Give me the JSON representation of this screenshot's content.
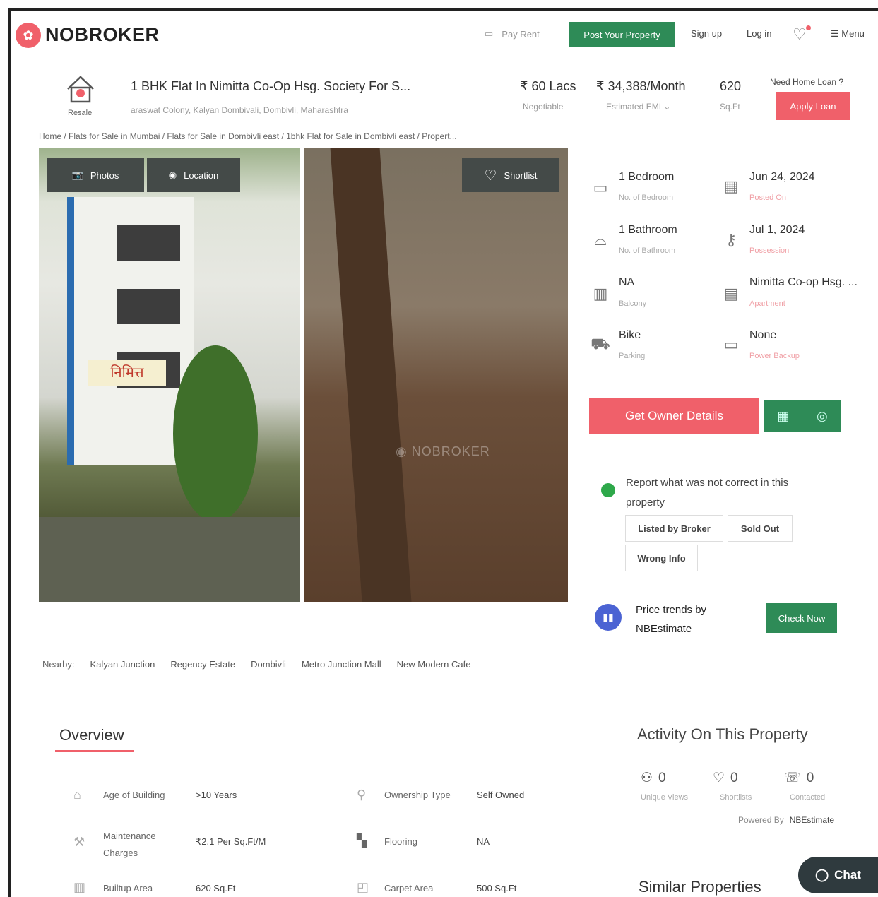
{
  "header": {
    "logo": "NOBROKER",
    "pay_rent": "Pay Rent",
    "post_property": "Post Your Property",
    "sign_up": "Sign up",
    "log_in": "Log in",
    "menu": "Menu"
  },
  "listing": {
    "type_label": "Resale",
    "title": "1 BHK Flat In Nimitta Co-Op Hsg. Society For S...",
    "address": "araswat Colony, Kalyan Dombivali, Dombivli, Maharashtra",
    "price": "₹ 60 Lacs",
    "price_note": "Negotiable",
    "emi": "₹ 34,388/Month",
    "emi_note": "Estimated EMI",
    "area": "620",
    "area_unit": "Sq.Ft",
    "loan_question": "Need Home Loan ?",
    "apply_loan": "Apply Loan"
  },
  "breadcrumb": "Home / Flats for Sale in Mumbai / Flats for Sale in Dombivli east / 1bhk Flat for Sale in Dombivli east / Propert...",
  "gallery": {
    "photos": "Photos",
    "location": "Location",
    "shortlist": "Shortlist",
    "sign_text": "निमित्त",
    "watermark": "NOBROKER"
  },
  "specs": [
    {
      "value": "1 Bedroom",
      "label": "No. of Bedroom",
      "icon": "bed-icon"
    },
    {
      "value": "Jun 24, 2024",
      "label": "Posted On",
      "icon": "calendar-icon"
    },
    {
      "value": "1 Bathroom",
      "label": "No. of Bathroom",
      "icon": "bathtub-icon"
    },
    {
      "value": "Jul 1, 2024",
      "label": "Possession",
      "icon": "key-icon"
    },
    {
      "value": "NA",
      "label": "Balcony",
      "icon": "balcony-icon"
    },
    {
      "value": "Nimitta Co-op Hsg. ...",
      "label": "Apartment",
      "icon": "building-icon"
    },
    {
      "value": "Bike",
      "label": "Parking",
      "icon": "car-icon"
    },
    {
      "value": "None",
      "label": "Power Backup",
      "icon": "battery-icon"
    }
  ],
  "actions": {
    "get_owner": "Get Owner Details"
  },
  "report": {
    "text": "Report what was not correct in this property",
    "chips": [
      "Listed by Broker",
      "Sold Out",
      "Wrong Info"
    ]
  },
  "price_trends": {
    "text": "Price trends by NBEstimate",
    "button": "Check Now"
  },
  "nearby": {
    "label": "Nearby:",
    "items": [
      "Kalyan Junction",
      "Regency Estate",
      "Dombivli",
      "Metro Junction Mall",
      "New Modern Cafe"
    ]
  },
  "overview": {
    "title": "Overview",
    "rows": [
      {
        "label": "Age of Building",
        "value": ">10 Years",
        "icon": "building-age-icon"
      },
      {
        "label": "Ownership Type",
        "value": "Self Owned",
        "icon": "ownership-icon"
      },
      {
        "label": "Maintenance Charges",
        "value": "₹2.1 Per Sq.Ft/M",
        "icon": "tools-icon"
      },
      {
        "label": "Flooring",
        "value": "NA",
        "icon": "flooring-icon"
      },
      {
        "label": "Builtup Area",
        "value": "620 Sq.Ft",
        "icon": "builtup-icon"
      },
      {
        "label": "Carpet Area",
        "value": "500 Sq.Ft",
        "icon": "carpet-icon"
      }
    ]
  },
  "activity": {
    "title": "Activity On This Property",
    "stats": [
      {
        "value": "0",
        "label": "Unique Views",
        "icon": "user-icon"
      },
      {
        "value": "0",
        "label": "Shortlists",
        "icon": "heart-icon"
      },
      {
        "value": "0",
        "label": "Contacted",
        "icon": "phone-icon"
      }
    ],
    "powered_by": "Powered By",
    "powered_name": "NBEstimate"
  },
  "similar": "Similar Properties",
  "chat": "Chat",
  "colors": {
    "brand_red": "#f0606a",
    "brand_green": "#2e8b57"
  }
}
